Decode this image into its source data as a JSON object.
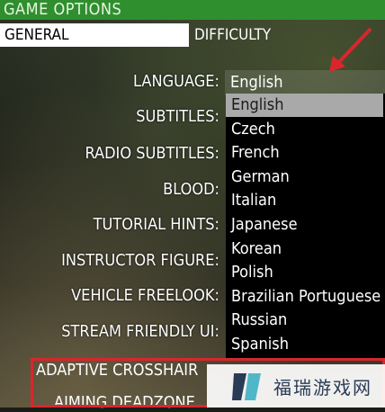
{
  "header": {
    "title": "GAME OPTIONS"
  },
  "tabs": [
    {
      "label": "GENERAL"
    },
    {
      "label": "DIFFICULTY"
    }
  ],
  "settings": [
    {
      "label": "LANGUAGE:"
    },
    {
      "label": "SUBTITLES:"
    },
    {
      "label": "RADIO SUBTITLES:"
    },
    {
      "label": "BLOOD:"
    },
    {
      "label": "TUTORIAL HINTS:"
    },
    {
      "label": "INSTRUCTOR FIGURE:"
    },
    {
      "label": "VEHICLE FREELOOK:"
    },
    {
      "label": "STREAM FRIENDLY UI:"
    },
    {
      "label": "ADAPTIVE CROSSHAIR"
    },
    {
      "label": "AIMING DEADZONE"
    }
  ],
  "language_value": "English",
  "language_options": [
    "English",
    "Czech",
    "French",
    "German",
    "Italian",
    "Japanese",
    "Korean",
    "Polish",
    "Brazilian Portuguese",
    "Russian",
    "Spanish"
  ],
  "watermark": {
    "text": "福瑞游戏网"
  },
  "colors": {
    "header": "#2f8f2f",
    "highlight": "#a9a9a9",
    "annotation": "#d9262d"
  }
}
